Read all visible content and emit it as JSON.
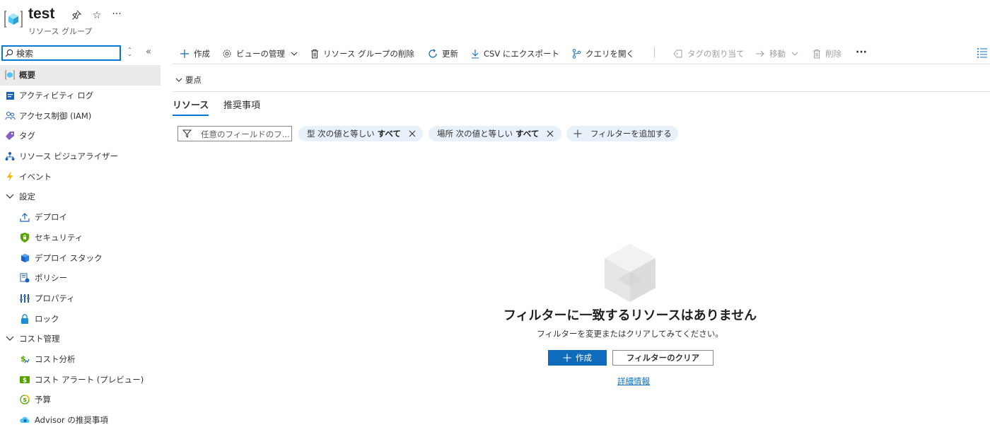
{
  "header": {
    "title": "test",
    "subtitle": "リソース グループ",
    "pin_glyph": "☆",
    "more_glyph": "···"
  },
  "sidebar": {
    "search": {
      "value": "検索",
      "placeholder": "検索"
    },
    "collapse_glyph": "«",
    "sort_glyph": "⌃⌄",
    "items": [
      {
        "label": "概要",
        "icon": "resource-group-icon",
        "level": 0,
        "active": true
      },
      {
        "label": "アクティビティ ログ",
        "icon": "activity-log-icon",
        "level": 0
      },
      {
        "label": "アクセス制御 (IAM)",
        "icon": "people-icon",
        "level": 0
      },
      {
        "label": "タグ",
        "icon": "tag-icon",
        "level": 0
      },
      {
        "label": "リソース ビジュアライザー",
        "icon": "visualizer-icon",
        "level": 0
      },
      {
        "label": "イベント",
        "icon": "lightning-icon",
        "level": 0
      },
      {
        "label": "設定",
        "icon": "chevron-down-icon",
        "level": 0
      },
      {
        "label": "デプロイ",
        "icon": "upload-icon",
        "level": 1
      },
      {
        "label": "セキュリティ",
        "icon": "shield-icon",
        "level": 1
      },
      {
        "label": "デプロイ スタック",
        "icon": "cube-stack-icon",
        "level": 1
      },
      {
        "label": "ポリシー",
        "icon": "policy-icon",
        "level": 1
      },
      {
        "label": "プロパティ",
        "icon": "properties-icon",
        "level": 1
      },
      {
        "label": "ロック",
        "icon": "lock-icon",
        "level": 1
      },
      {
        "label": "コスト管理",
        "icon": "chevron-down-icon",
        "level": 0
      },
      {
        "label": "コスト分析",
        "icon": "cost-analysis-icon",
        "level": 1
      },
      {
        "label": "コスト アラート (プレビュー)",
        "icon": "cost-alert-icon",
        "level": 1
      },
      {
        "label": "予算",
        "icon": "budget-icon",
        "level": 1
      },
      {
        "label": "Advisor の推奨事項",
        "icon": "advisor-icon",
        "level": 1
      }
    ]
  },
  "toolbar": {
    "create": "作成",
    "manage_view": "ビューの管理",
    "delete_rg": "リソース グループの削除",
    "refresh": "更新",
    "export_csv": "CSV にエクスポート",
    "open_query": "クエリを開く",
    "assign_tags": "タグの割り当て",
    "move": "移動",
    "delete": "削除",
    "more": "···"
  },
  "essentials": {
    "label": "要点"
  },
  "tabs": [
    {
      "label": "リソース",
      "selected": true
    },
    {
      "label": "推奨事項",
      "selected": false
    }
  ],
  "filters": {
    "placeholder": "任意のフィールドのフ...",
    "pills": [
      {
        "label": "型 次の値と等しい",
        "value": "すべて"
      },
      {
        "label": "場所 次の値と等しい",
        "value": "すべて"
      }
    ],
    "add_filter": "フィルターを追加する"
  },
  "empty_state": {
    "title": "フィルターに一致するリソースはありません",
    "description": "フィルターを変更またはクリアしてみてください。",
    "create_button": "作成",
    "clear_button": "フィルターのクリア",
    "learn_more": "詳細情報"
  },
  "colors": {
    "accent": "#0f6cbd",
    "pill_bg": "#e8f0fa",
    "active_nav_bg": "#edebe9"
  }
}
